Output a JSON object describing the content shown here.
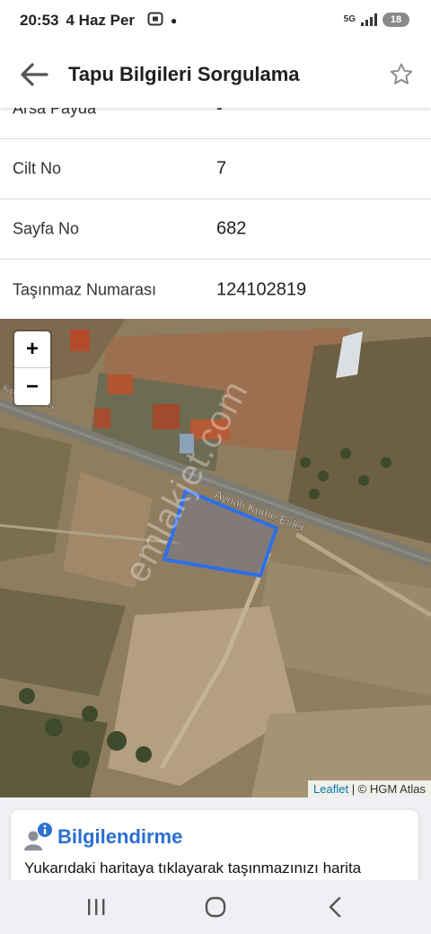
{
  "status_bar": {
    "time": "20:53",
    "date": "4 Haz Per",
    "notification_icons": [
      "screenshot-icon",
      "dot-icon"
    ],
    "network": "5G",
    "battery": "18"
  },
  "app_bar": {
    "title": "Tapu Bilgileri Sorgulama",
    "back_icon": "arrow-left-icon",
    "favorite_icon": "star-outline-icon"
  },
  "rows": [
    {
      "label": "Arsa Payda",
      "value": "-"
    },
    {
      "label": "Cilt No",
      "value": "7"
    },
    {
      "label": "Sayfa No",
      "value": "682"
    },
    {
      "label": "Taşınmaz Numarası",
      "value": "124102819"
    }
  ],
  "map": {
    "zoom_in": "+",
    "zoom_out": "−",
    "road_label": "Aynalı Küme Evler",
    "road_label_left": "Küme Evler",
    "watermark": "emlakjet.com",
    "attribution_leaflet": "Leaflet",
    "attribution_rest": " | © HGM Atlas",
    "parcel_color": "#2f6fe6"
  },
  "info_card": {
    "title": "Bilgilendirme",
    "text": "Yukarıdaki haritaya tıklayarak taşınmazınızı harita",
    "accent": "#2b6fd0"
  },
  "nav_bar": {
    "items": [
      "recent-apps-icon",
      "home-icon",
      "back-icon"
    ]
  }
}
